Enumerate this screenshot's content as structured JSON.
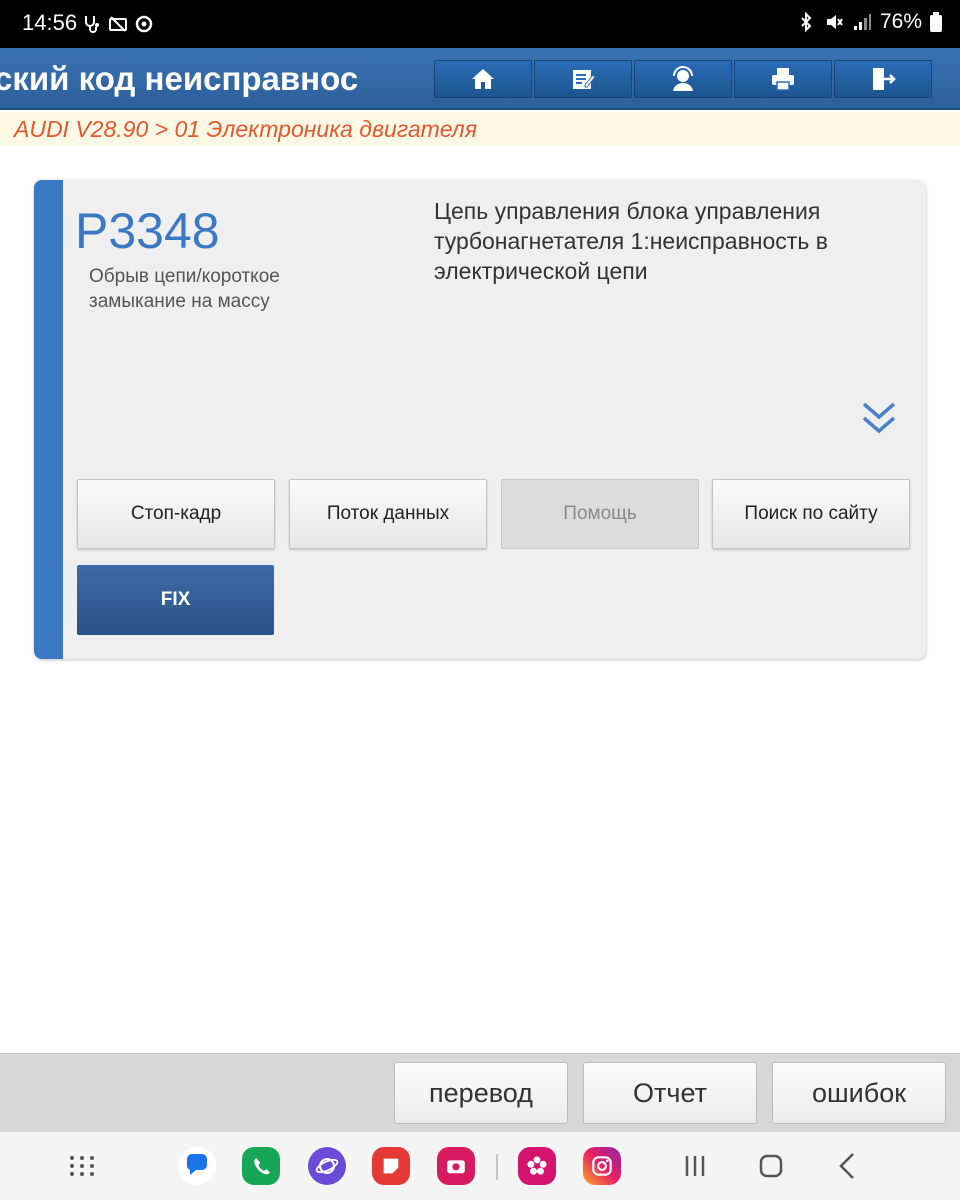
{
  "status_bar": {
    "time": "14:56",
    "battery": "76%",
    "icons": [
      "stethoscope-icon",
      "sim-off-icon",
      "sync-icon",
      "bluetooth-icon",
      "mute-icon",
      "signal-icon",
      "battery-icon"
    ]
  },
  "header": {
    "title": "ский код неисправнос",
    "toolbar": [
      "home-icon",
      "edit-note-icon",
      "support-icon",
      "print-icon",
      "exit-icon"
    ]
  },
  "breadcrumb": "AUDI V28.90 > 01 Электроника двигателя",
  "dtc": {
    "code": "P3348",
    "status": "Обрыв цепи/короткое замыкание на массу",
    "description": "Цепь управления блока управления турбонагнетателя 1:неисправность в электрической цепи"
  },
  "buttons": {
    "freeze_frame": "Стоп-кадр",
    "data_stream": "Поток данных",
    "help": "Помощь",
    "site_search": "Поиск по сайту",
    "fix": "FIX"
  },
  "bottom_buttons": {
    "translate": "перевод",
    "report": "Отчет",
    "errors": "ошибок"
  },
  "colors": {
    "accent": "#3a78c4",
    "header": "#2d5f9b",
    "breadcrumb_text": "#e4572e",
    "fix_button": "#2b5286"
  },
  "navbar": {
    "icons": [
      "apps-grid-icon",
      "messages-app-icon",
      "phone-app-icon",
      "internet-app-icon",
      "notes-app-icon",
      "camera-app-icon",
      "gallery-app-icon",
      "instagram-app-icon",
      "recents-icon",
      "home-nav-icon",
      "back-icon"
    ]
  }
}
